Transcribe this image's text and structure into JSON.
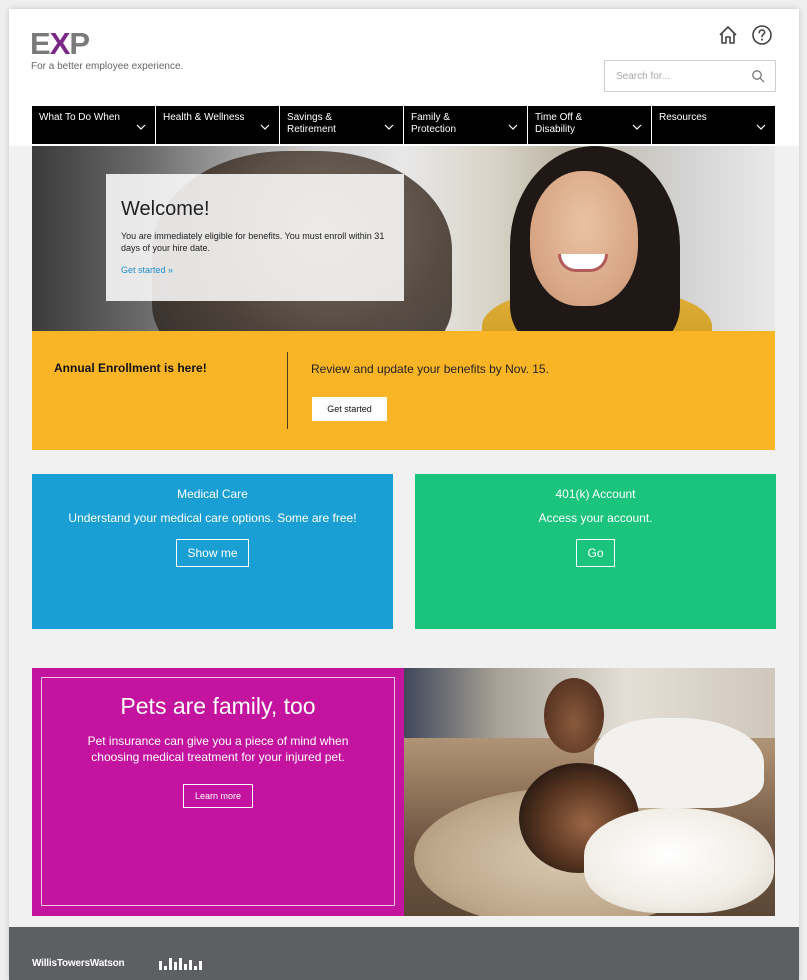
{
  "brand": {
    "logo_prefix": "E",
    "logo_accent": "X",
    "logo_suffix": "P",
    "tagline": "For a better employee experience.",
    "accent_color": "#7a2a86"
  },
  "header": {
    "home_icon": "home-icon",
    "help_icon": "help-icon"
  },
  "search": {
    "placeholder": "Search for...",
    "icon": "search-icon"
  },
  "nav": {
    "items": [
      {
        "label": "What To Do When"
      },
      {
        "label": "Health & Wellness"
      },
      {
        "label": "Savings & Retirement"
      },
      {
        "label": "Family & Protection"
      },
      {
        "label": "Time Off & Disability"
      },
      {
        "label": "Resources"
      }
    ]
  },
  "hero": {
    "title": "Welcome!",
    "body": "You are immediately eligible for benefits. You must enroll within 31 days of your hire date.",
    "link": "Get started »"
  },
  "enrollment": {
    "label": "Annual Enrollment is here!",
    "message": "Review and update your benefits by Nov. 15.",
    "button": "Get started",
    "color": "#fab526"
  },
  "tiles": {
    "medical": {
      "title": "Medical Care",
      "subtitle": "Understand your medical care options. Some are free!",
      "button": "Show me",
      "color": "#1a9fd5"
    },
    "k401": {
      "title": "401(k) Account",
      "subtitle": "Access your account.",
      "button": "Go",
      "color": "#1ac47c"
    }
  },
  "pets": {
    "title": "Pets are family, too",
    "body": "Pet insurance can give you a piece of mind when choosing medical treatment for your injured pet.",
    "button": "Learn more",
    "color": "#c4139f"
  },
  "footer": {
    "company": "WillisTowersWatson"
  }
}
